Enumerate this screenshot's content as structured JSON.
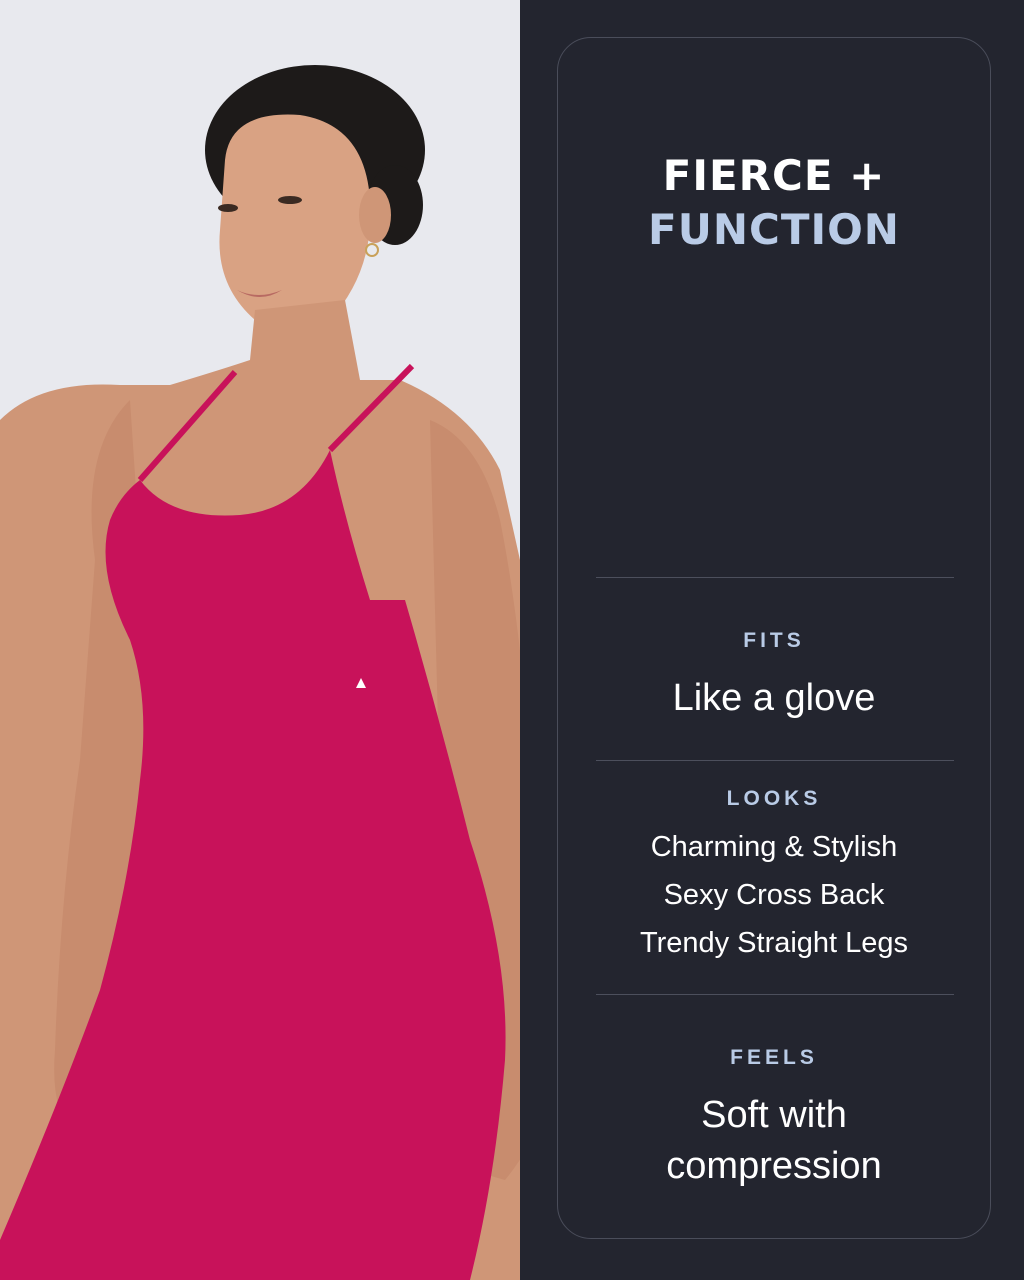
{
  "headline": {
    "line1": "FIERCE +",
    "line2": "FUNCTION"
  },
  "sections": {
    "fits": {
      "label": "FITS",
      "text": "Like a glove"
    },
    "looks": {
      "label": "LOOKS",
      "items": [
        "Charming & Stylish",
        "Sexy Cross Back",
        "Trendy Straight Legs"
      ]
    },
    "feels": {
      "label": "FEELS",
      "line1": "Soft with",
      "line2": "compression"
    }
  },
  "colors": {
    "panel": "#23252f",
    "accent": "#b9cbe6",
    "garment": "#c8125a",
    "background": "#e8e9ee"
  }
}
